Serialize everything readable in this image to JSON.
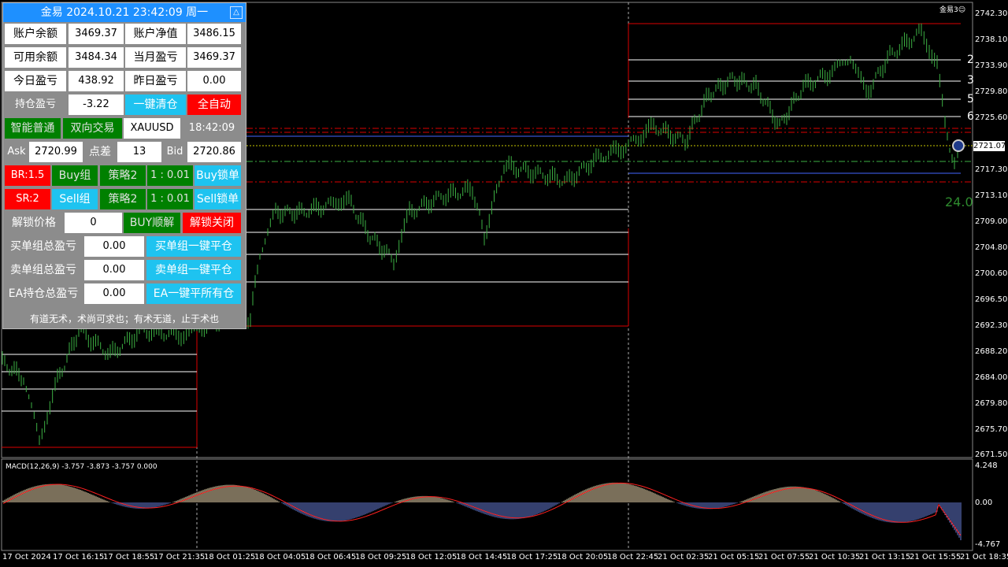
{
  "panel": {
    "title": "金易 2024.10.21 23:42:09 周一",
    "title_btn": "△",
    "rows": [
      [
        "账户余额",
        "3469.37",
        "账户净值",
        "3486.15"
      ],
      [
        "可用余额",
        "3484.34",
        "当月盈亏",
        "3469.37"
      ],
      [
        "今日盈亏",
        "438.92",
        "昨日盈亏",
        "0.00"
      ]
    ],
    "position_label": "持仓盈亏",
    "position_value": "-3.22",
    "close_all_btn": "一键清仓",
    "auto_btn": "全自动",
    "smart_btn": "智能普通",
    "twoway_btn": "双向交易",
    "symbol": "XAUUSD",
    "time": "18:42:09",
    "ask_label": "Ask",
    "ask_value": "2720.99",
    "spread_label": "点差",
    "spread_value": "13",
    "bid_label": "Bid",
    "bid_value": "2720.86",
    "br": "BR:1.5",
    "buy_group": "Buy组",
    "strategy": "策略2",
    "ratio": "1 : 0.01",
    "buy_lock": "Buy锁单",
    "sr": "SR:2",
    "sell_group": "Sell组",
    "sell_lock": "Sell锁单",
    "unlock_label": "解锁价格",
    "unlock_value": "0",
    "buy_unlock": "BUY顺解",
    "unlock_close": "解锁关闭",
    "buy_total_label": "买单组总盈亏",
    "buy_total_value": "0.00",
    "buy_close_btn": "买单组一键平仓",
    "sell_total_label": "卖单组总盈亏",
    "sell_total_value": "0.00",
    "sell_close_btn": "卖单组一键平仓",
    "ea_total_label": "EA持仓总盈亏",
    "ea_total_value": "0.00",
    "ea_close_btn": "EA一键平所有仓",
    "motto": "有道无术，术尚可求也；有术无道，止于术也"
  },
  "chart": {
    "top_right_label": "金易3",
    "current_price": "2721.07",
    "big_number": "24.0",
    "level_labels": [
      "2",
      "3",
      "5",
      "6"
    ],
    "price_axis": [
      "2742.30",
      "2738.10",
      "2733.90",
      "2729.80",
      "2725.60",
      "2717.30",
      "2713.10",
      "2709.00",
      "2704.80",
      "2700.60",
      "2696.50",
      "2692.30",
      "2688.20",
      "2684.00",
      "2679.80",
      "2675.70",
      "2671.50"
    ],
    "macd_label": "MACD(12,26,9) -3.757 -3.873 -3.757 0.000",
    "macd_axis": [
      "4.248",
      "0.00",
      "-4.767"
    ],
    "time_axis": [
      "17 Oct 2024",
      "17 Oct 16:15",
      "17 Oct 18:55",
      "17 Oct 21:35",
      "18 Oct 01:25",
      "18 Oct 04:05",
      "18 Oct 06:45",
      "18 Oct 09:25",
      "18 Oct 12:05",
      "18 Oct 14:45",
      "18 Oct 17:25",
      "18 Oct 20:05",
      "18 Oct 22:45",
      "21 Oct 02:35",
      "21 Oct 05:15",
      "21 Oct 07:55",
      "21 Oct 10:35",
      "21 Oct 13:15",
      "21 Oct 15:55",
      "21 Oct 18:35"
    ]
  },
  "colors": {
    "candle": "#3cb043",
    "panel_bg": "#8c8c8c",
    "accent_blue": "#1ec3f0",
    "red": "#ff0000",
    "green": "#008000"
  }
}
